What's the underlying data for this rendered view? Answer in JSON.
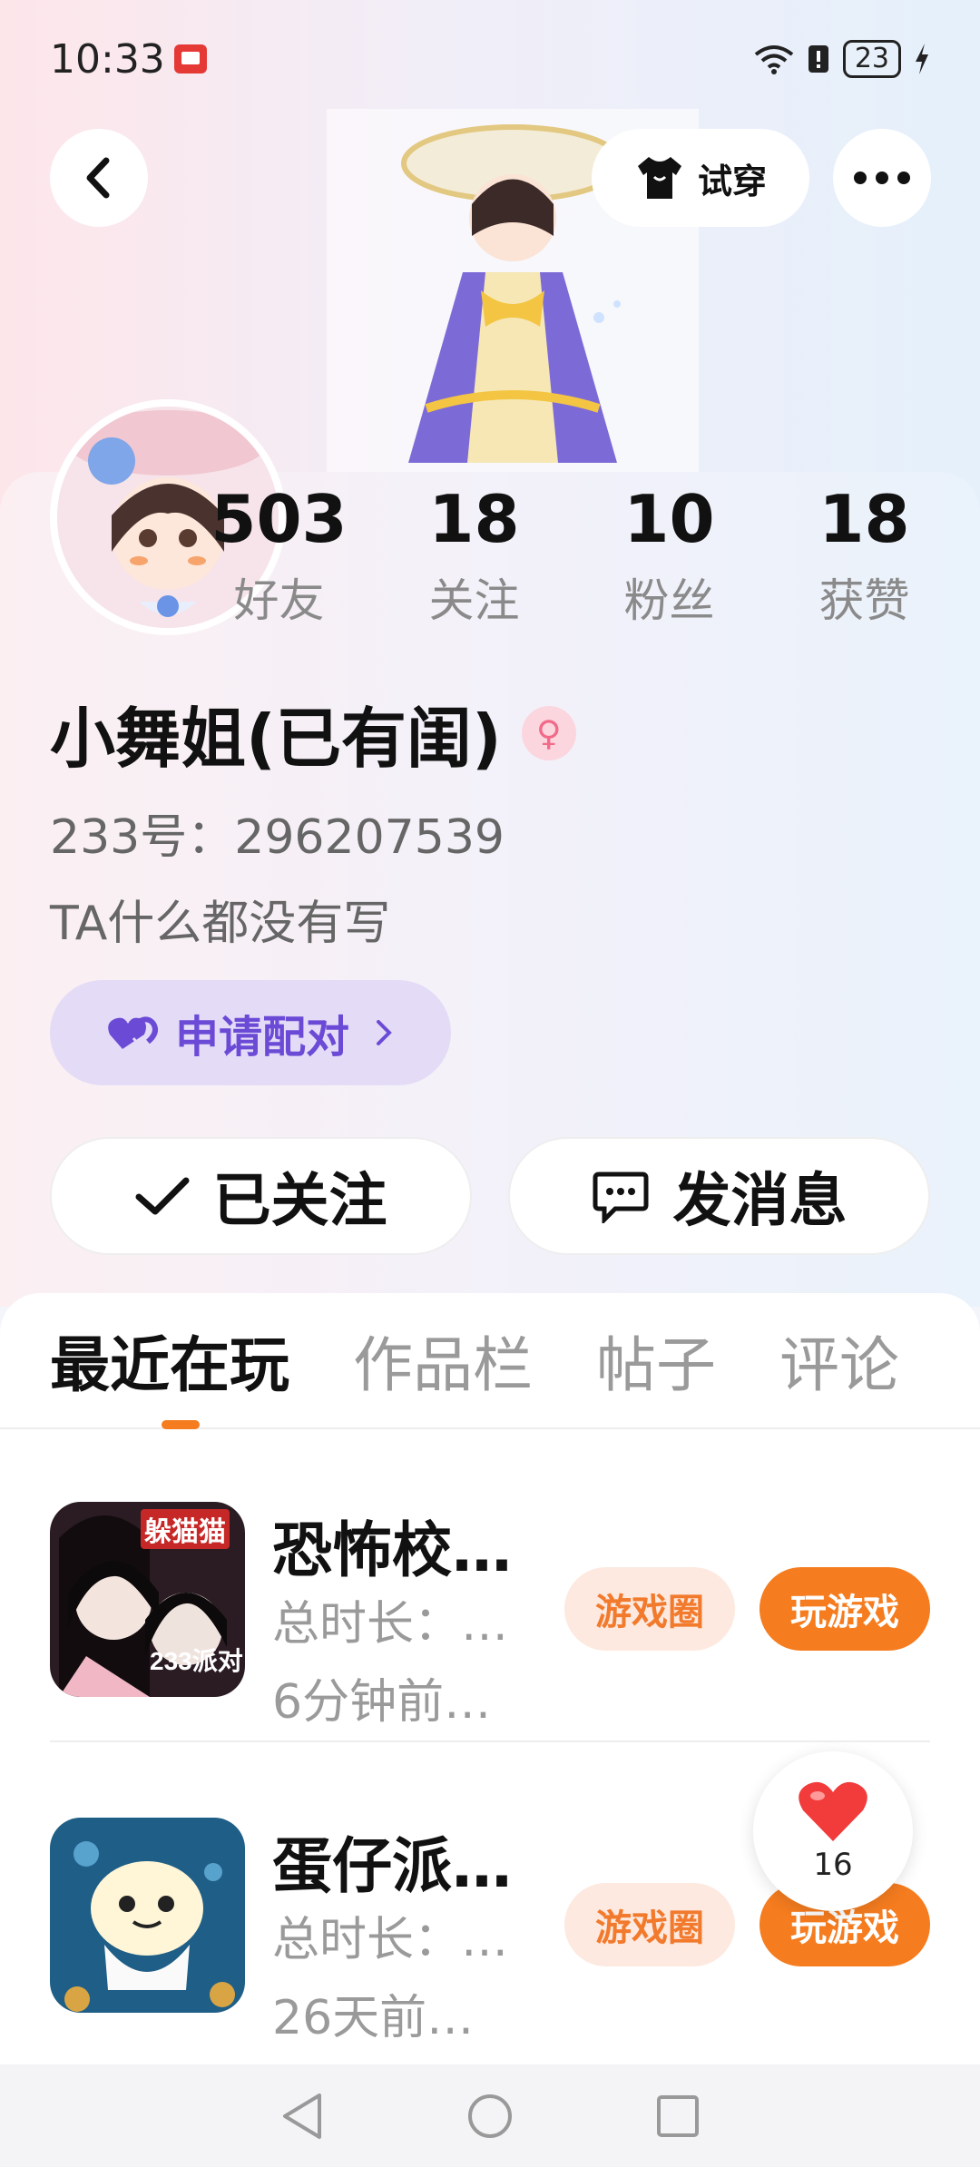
{
  "status_bar": {
    "time": "10:33",
    "battery": "23"
  },
  "header": {
    "tryon_label": "试穿"
  },
  "stats": [
    {
      "value": "503",
      "label": "好友"
    },
    {
      "value": "18",
      "label": "关注"
    },
    {
      "value": "10",
      "label": "粉丝"
    },
    {
      "value": "18",
      "label": "获赞"
    }
  ],
  "profile": {
    "name": "小舞姐(已有闺)",
    "gender_symbol": "♀",
    "uid": "233号：296207539",
    "bio": "TA什么都没有写",
    "pair_label": "申请配对"
  },
  "actions": {
    "follow_label": "已关注",
    "message_label": "发消息"
  },
  "tabs": [
    "最近在玩",
    "作品栏",
    "帖子",
    "评论"
  ],
  "games": [
    {
      "title": "恐怖校…",
      "duration": "总时长：…",
      "time": "6分钟前…",
      "circle_label": "游戏圈",
      "play_label": "玩游戏",
      "badge": "躲猫猫"
    },
    {
      "title": "蛋仔派…",
      "duration": "总时长：…",
      "time": "26天前…",
      "circle_label": "游戏圈",
      "play_label": "玩游戏"
    }
  ],
  "like_float": {
    "count": "16"
  },
  "colors": {
    "accent": "#f57c1f",
    "pair_purple": "#6b4bd6",
    "pink_badge": "#f16a8a"
  }
}
